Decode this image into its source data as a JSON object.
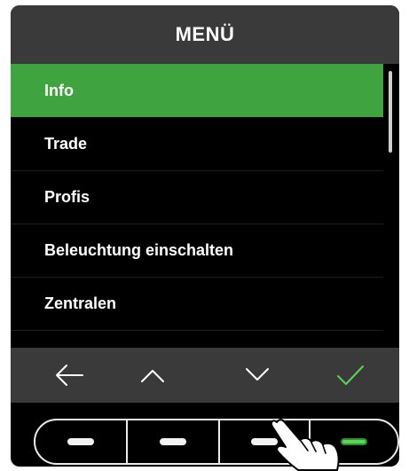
{
  "header": {
    "title": "MENÜ"
  },
  "menu": {
    "items": [
      {
        "label": "Info",
        "selected": true
      },
      {
        "label": "Trade",
        "selected": false
      },
      {
        "label": "Profis",
        "selected": false
      },
      {
        "label": "Beleuchtung einschalten",
        "selected": false
      },
      {
        "label": "Zentralen",
        "selected": false
      }
    ]
  },
  "navbar": {
    "buttons": [
      {
        "icon": "arrow-left-icon"
      },
      {
        "icon": "chevron-up-icon"
      },
      {
        "icon": "chevron-down-icon"
      },
      {
        "icon": "checkmark-icon"
      }
    ]
  },
  "physical_buttons": {
    "count": 4,
    "confirm_color": "#5bd45b"
  },
  "colors": {
    "accent": "#3fa43f",
    "header": "#3a3a3a",
    "background": "#000000"
  }
}
